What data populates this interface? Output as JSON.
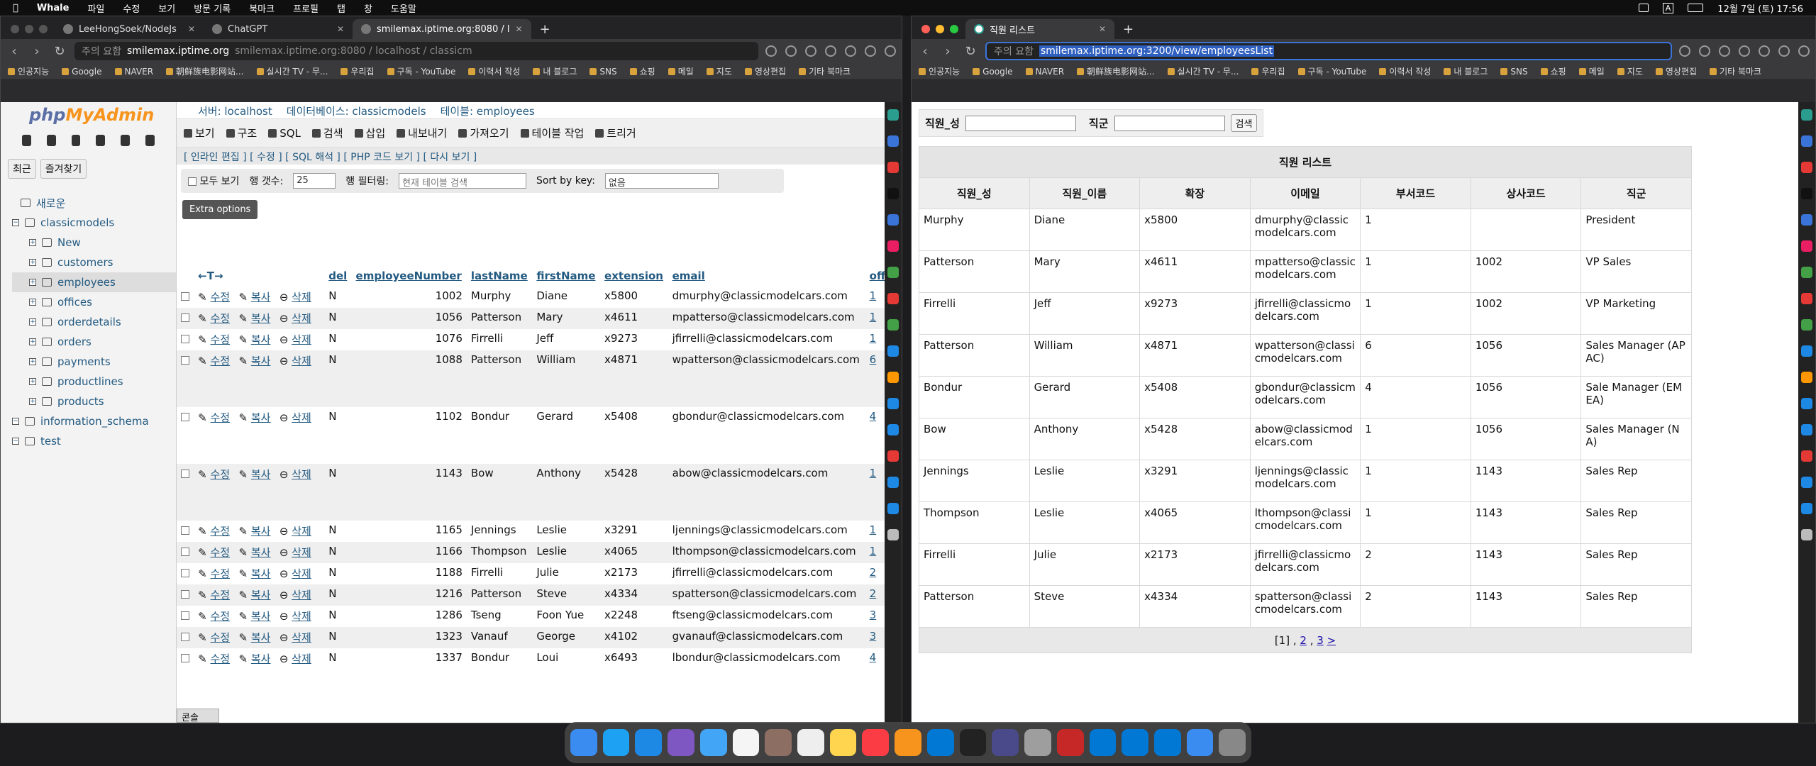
{
  "menubar": {
    "app": "Whale",
    "items": [
      "파일",
      "수정",
      "보기",
      "방문 기록",
      "북마크",
      "프로필",
      "탭",
      "창",
      "도움말"
    ],
    "clock": "12월 7일 (토) 17:56",
    "input_indicator": "A"
  },
  "left_window": {
    "tabs": [
      {
        "label": "LeeHongSoek/NodeJs",
        "active": false
      },
      {
        "label": "ChatGPT",
        "active": false
      },
      {
        "label": "smilemax.iptime.org:8080 / l",
        "active": true
      }
    ],
    "address": {
      "warning": "주의 요함",
      "host": "smilemax.iptime.org",
      "rest": "smilemax.iptime.org:8080 / localhost / classicm"
    },
    "bookmarks": [
      "인공지능",
      "Google",
      "NAVER",
      "朝鲜族电影网站...",
      "실시간 TV - 무...",
      "우리집",
      "구독 - YouTube",
      "이력서 작성",
      "내 블로그",
      "SNS",
      "쇼핑",
      "메일",
      "지도",
      "영상편집",
      "기타 북마크"
    ]
  },
  "pma": {
    "logo_a": "php",
    "logo_b": "MyAdmin",
    "nav_tabs": [
      "최근",
      "즐겨찾기"
    ],
    "tree": [
      {
        "label": "새로운",
        "level": 1
      },
      {
        "label": "classicmodels",
        "level": 0
      },
      {
        "label": "New",
        "level": 2
      },
      {
        "label": "customers",
        "level": 2
      },
      {
        "label": "employees",
        "level": 2,
        "selected": true
      },
      {
        "label": "offices",
        "level": 2
      },
      {
        "label": "orderdetails",
        "level": 2
      },
      {
        "label": "orders",
        "level": 2
      },
      {
        "label": "payments",
        "level": 2
      },
      {
        "label": "productlines",
        "level": 2
      },
      {
        "label": "products",
        "level": 2
      },
      {
        "label": "information_schema",
        "level": 0
      },
      {
        "label": "test",
        "level": 0
      }
    ],
    "breadcrumb": {
      "server": "서버: localhost",
      "database": "데이터베이스: classicmodels",
      "table": "테이블: employees"
    },
    "tabs": [
      "보기",
      "구조",
      "SQL",
      "검색",
      "삽입",
      "내보내기",
      "가져오기",
      "테이블 작업",
      "트리거"
    ],
    "edit_links": "[ 인라인 편집 ] [ 수정 ] [ SQL 해석 ] [ PHP 코드 보기 ] [ 다시 보기 ]",
    "controls": {
      "show_all": "모두 보기",
      "rows_label": "행 갯수:",
      "rows_value": "25",
      "filter_label": "행 필터링:",
      "filter_placeholder": "현재 테이블 검색",
      "sortkey_label": "Sort by key:",
      "sortkey_value": "없음"
    },
    "extra_options": "Extra options",
    "columns": [
      "del",
      "employeeNumber",
      "lastName",
      "firstName",
      "extension",
      "email",
      "offi"
    ],
    "sort_arrows": "←T→",
    "row_actions": {
      "edit": "수정",
      "copy": "복사",
      "delete": "삭제"
    },
    "rows": [
      {
        "del": "N",
        "num": "1002",
        "last": "Murphy",
        "first": "Diane",
        "ext": "x5800",
        "email": "dmurphy@classicmodelcars.com",
        "office": "1"
      },
      {
        "del": "N",
        "num": "1056",
        "last": "Patterson",
        "first": "Mary",
        "ext": "x4611",
        "email": "mpatterso@classicmodelcars.com",
        "office": "1"
      },
      {
        "del": "N",
        "num": "1076",
        "last": "Firrelli",
        "first": "Jeff",
        "ext": "x9273",
        "email": "jfirrelli@classicmodelcars.com",
        "office": "1"
      },
      {
        "del": "N",
        "num": "1088",
        "last": "Patterson",
        "first": "William",
        "ext": "x4871",
        "email": "wpatterson@classicmodelcars.com",
        "office": "6"
      },
      {
        "del": "N",
        "num": "1102",
        "last": "Bondur",
        "first": "Gerard",
        "ext": "x5408",
        "email": "gbondur@classicmodelcars.com",
        "office": "4"
      },
      {
        "del": "N",
        "num": "1143",
        "last": "Bow",
        "first": "Anthony",
        "ext": "x5428",
        "email": "abow@classicmodelcars.com",
        "office": "1"
      },
      {
        "del": "N",
        "num": "1165",
        "last": "Jennings",
        "first": "Leslie",
        "ext": "x3291",
        "email": "ljennings@classicmodelcars.com",
        "office": "1"
      },
      {
        "del": "N",
        "num": "1166",
        "last": "Thompson",
        "first": "Leslie",
        "ext": "x4065",
        "email": "lthompson@classicmodelcars.com",
        "office": "1"
      },
      {
        "del": "N",
        "num": "1188",
        "last": "Firrelli",
        "first": "Julie",
        "ext": "x2173",
        "email": "jfirrelli@classicmodelcars.com",
        "office": "2"
      },
      {
        "del": "N",
        "num": "1216",
        "last": "Patterson",
        "first": "Steve",
        "ext": "x4334",
        "email": "spatterson@classicmodelcars.com",
        "office": "2"
      },
      {
        "del": "N",
        "num": "1286",
        "last": "Tseng",
        "first": "Foon Yue",
        "ext": "x2248",
        "email": "ftseng@classicmodelcars.com",
        "office": "3"
      },
      {
        "del": "N",
        "num": "1323",
        "last": "Vanauf",
        "first": "George",
        "ext": "x4102",
        "email": "gvanauf@classicmodelcars.com",
        "office": "3"
      },
      {
        "del": "N",
        "num": "1337",
        "last": "Bondur",
        "first": "Loui",
        "ext": "x6493",
        "email": "lbondur@classicmodelcars.com",
        "office": "4"
      }
    ],
    "console": "콘솔"
  },
  "right_window": {
    "tab": "직원 리스트",
    "address": {
      "warning": "주의 요함",
      "url": "smilemax.iptime.org:3200/view/employeesList"
    },
    "search": {
      "lastname_label": "직원_성",
      "job_label": "직군",
      "button": "검색"
    },
    "table_caption": "직원 리스트",
    "headers": [
      "직원_성",
      "직원_이름",
      "확장",
      "이메일",
      "부서코드",
      "상사코드",
      "직군"
    ],
    "rows": [
      [
        "Murphy",
        "Diane",
        "x5800",
        "dmurphy@classicmodelcars.com",
        "1",
        "",
        "President"
      ],
      [
        "Patterson",
        "Mary",
        "x4611",
        "mpatterso@classicmodelcars.com",
        "1",
        "1002",
        "VP Sales"
      ],
      [
        "Firrelli",
        "Jeff",
        "x9273",
        "jfirrelli@classicmodelcars.com",
        "1",
        "1002",
        "VP Marketing"
      ],
      [
        "Patterson",
        "William",
        "x4871",
        "wpatterson@classicmodelcars.com",
        "6",
        "1056",
        "Sales Manager (APAC)"
      ],
      [
        "Bondur",
        "Gerard",
        "x5408",
        "gbondur@classicmodelcars.com",
        "4",
        "1056",
        "Sale Manager (EMEA)"
      ],
      [
        "Bow",
        "Anthony",
        "x5428",
        "abow@classicmodelcars.com",
        "1",
        "1056",
        "Sales Manager (NA)"
      ],
      [
        "Jennings",
        "Leslie",
        "x3291",
        "ljennings@classicmodelcars.com",
        "1",
        "1143",
        "Sales Rep"
      ],
      [
        "Thompson",
        "Leslie",
        "x4065",
        "lthompson@classicmodelcars.com",
        "1",
        "1143",
        "Sales Rep"
      ],
      [
        "Firrelli",
        "Julie",
        "x2173",
        "jfirrelli@classicmodelcars.com",
        "2",
        "1143",
        "Sales Rep"
      ],
      [
        "Patterson",
        "Steve",
        "x4334",
        "spatterson@classicmodelcars.com",
        "2",
        "1143",
        "Sales Rep"
      ]
    ],
    "pager": {
      "current": "[1]",
      "p2": "2",
      "p3": "3",
      "next": ">"
    }
  },
  "colors": {
    "accent": "#3b74d8",
    "pma_link": "#235a81",
    "pma_orange": "#f7941d"
  }
}
